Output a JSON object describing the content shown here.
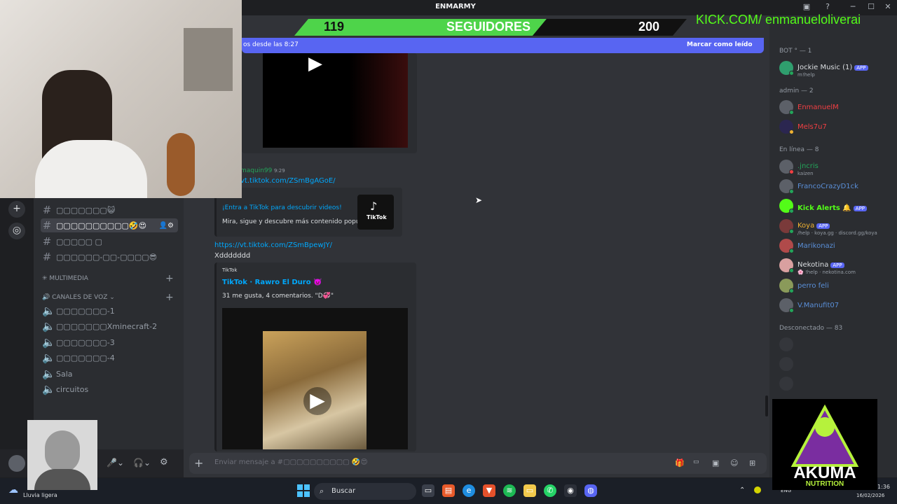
{
  "window": {
    "title": "ENMARMY"
  },
  "overlay": {
    "followers_current": "119",
    "followers_label": "SEGUIDORES",
    "followers_goal": "200",
    "kick_text": "KICK.COM/ enmanueloliverai"
  },
  "banner": {
    "text": "os desde las 8:27",
    "action": "Marcar como leído"
  },
  "channels": {
    "text": [
      {
        "name": "▢▢▢▢▢▢▢😺"
      },
      {
        "name": "▢▢▢▢▢▢▢▢▢▢🤣😍"
      },
      {
        "name": "▢▢▢▢▢ ▢"
      },
      {
        "name": "▢▢▢▢▢▢-▢▢-▢▢▢▢😎"
      }
    ],
    "cat_multimedia": "MULTIMEDIA",
    "cat_voice": "CANALES DE VOZ",
    "voice": [
      {
        "name": "▢▢▢▢▢▢▢-1"
      },
      {
        "name": "▢▢▢▢▢▢▢Xminecraft-2"
      },
      {
        "name": "▢▢▢▢▢▢▢-3"
      },
      {
        "name": "▢▢▢▢▢▢▢-4"
      },
      {
        "name": "Sala"
      },
      {
        "name": "circuitos"
      }
    ]
  },
  "messages": {
    "author": "maquin99",
    "time": "9:29",
    "link1": "vt.tiktok.com/ZSmBgAGoE/",
    "embed1_title": "¡Entra a TikTok para descubrir videos!",
    "embed1_desc": "Mira, sigue y descubre más contenido popular.",
    "tiktok_label": "TikTok",
    "link2": "https://vt.tiktok.com/ZSmBpewJY/",
    "text2": "Xddddddd",
    "embed2_provider": "TikTok",
    "embed2_title": "TikTok · Rawro El Duro 👿",
    "embed2_desc": "31 me gusta, 4 comentarios. \"D💞\""
  },
  "composer": {
    "placeholder": "Enviar mensaje a #▢▢▢▢▢▢▢▢▢▢ 🤣😍"
  },
  "members": {
    "groups": [
      {
        "label": "BOT ° — 1"
      },
      {
        "label": "admin — 2"
      },
      {
        "label": "En línea — 8"
      },
      {
        "label": "Desconectado — 83"
      }
    ],
    "bot": [
      {
        "name": "Jockie Music (1)",
        "sub": "m!help",
        "badge": "APP"
      }
    ],
    "admin": [
      {
        "name": "EnmanuelM"
      },
      {
        "name": "Mels7u7"
      }
    ],
    "online": [
      {
        "name": ".jncris",
        "sub": "kaizen"
      },
      {
        "name": "FrancoCrazyD1ck"
      },
      {
        "name": "Kick Alerts 🔔",
        "badge": "APP"
      },
      {
        "name": "Koya",
        "sub": "/help · koya.gg · discord.gg/koya",
        "badge": "APP"
      },
      {
        "name": "Marikonazi"
      },
      {
        "name": "Nekotina",
        "sub": "🌸 !help · nekotina.com",
        "badge": "APP"
      },
      {
        "name": "perro feli"
      },
      {
        "name": "V.Manufit07"
      }
    ]
  },
  "taskbar": {
    "weather": "Lluvia ligera",
    "search": "Buscar",
    "lang": "ENG",
    "time": "1:36",
    "date": "16/02/2026"
  },
  "logo": {
    "text": "AKUMA",
    "sub": "NUTRITION"
  },
  "colors": {
    "admin": "#f23f43",
    "online_status": "#23a55a",
    "accent": "#5865f2",
    "kick_green": "#53fc18"
  }
}
